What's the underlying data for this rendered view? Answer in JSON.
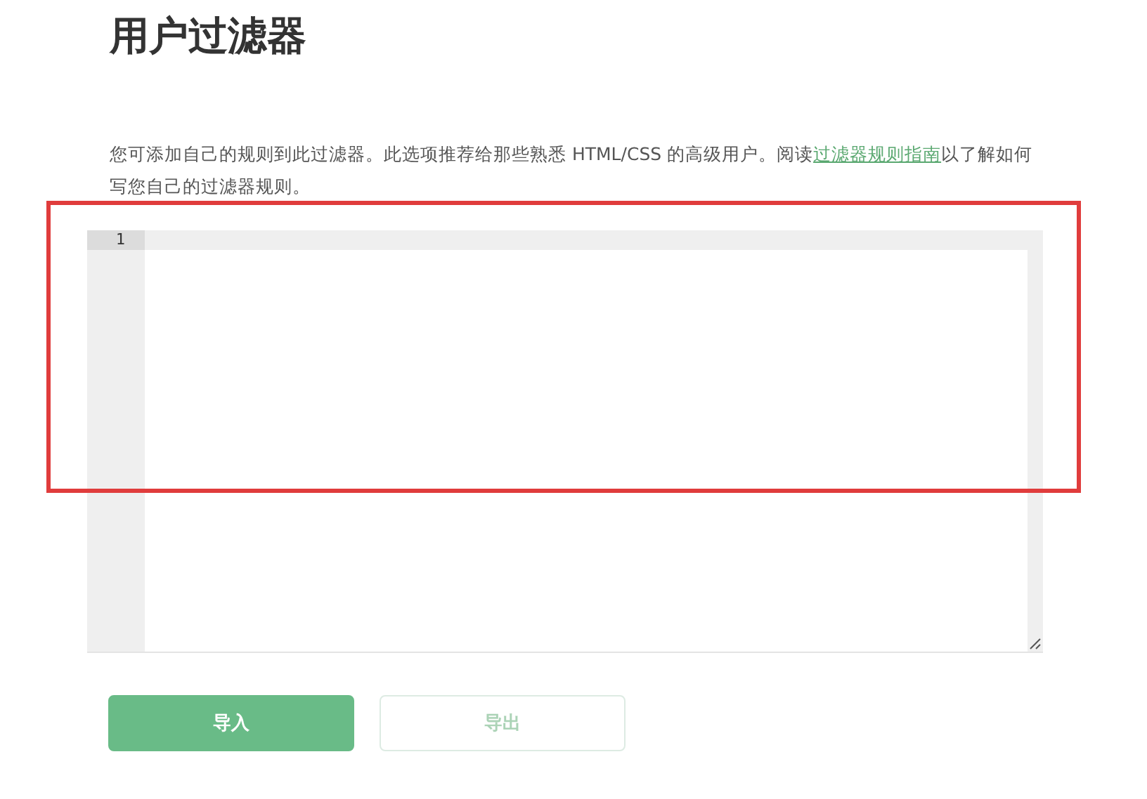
{
  "page": {
    "title": "用户过滤器"
  },
  "description": {
    "text_before": "您可添加自己的规则到此过滤器。此选项推荐给那些熟悉 HTML/CSS 的高级用户。阅读",
    "link": "过滤器规则指南",
    "text_after": "以了解如何写您自己的过滤器规则。"
  },
  "editor": {
    "line_numbers": [
      "1"
    ],
    "highlighted": true
  },
  "buttons": [
    {
      "label": "导入",
      "kind": "primary",
      "disabled": false
    },
    {
      "label": "导出",
      "kind": "secondary",
      "disabled": true
    }
  ]
}
